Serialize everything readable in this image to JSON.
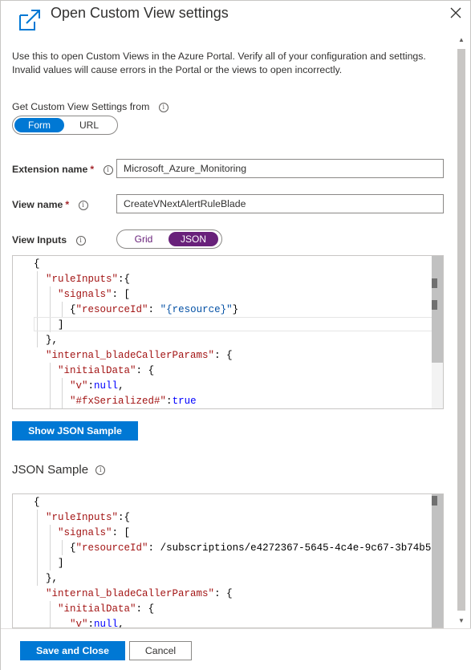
{
  "header": {
    "title": "Open Custom View settings",
    "icon": "open-external-icon",
    "close_icon": "close-icon"
  },
  "description": "Use this to open Custom Views in the Azure Portal. Verify all of your configuration and settings. Invalid values will cause errors in the Portal or the views to open incorrectly.",
  "source": {
    "label": "Get Custom View Settings from",
    "options": [
      "Form",
      "URL"
    ],
    "selected": "Form"
  },
  "extension": {
    "label": "Extension name",
    "required_mark": "*",
    "value": "Microsoft_Azure_Monitoring"
  },
  "view_name": {
    "label": "View name",
    "required_mark": "*",
    "value": "CreateVNextAlertRuleBlade"
  },
  "view_inputs": {
    "label": "View Inputs",
    "options": [
      "Grid",
      "JSON"
    ],
    "selected": "JSON"
  },
  "editor_lines": [
    "{",
    "  \"ruleInputs\":{",
    "    \"signals\": [",
    "      {\"resourceId\": \"{resource}\"}",
    "    ]",
    "  },",
    "  \"internal_bladeCallerParams\": {",
    "    \"initialData\": {",
    "      \"v\":null,",
    "      \"#fxSerialized#\":true"
  ],
  "show_sample_button": "Show JSON Sample",
  "sample": {
    "title": "JSON Sample",
    "lines": [
      "{",
      "  \"ruleInputs\":{",
      "    \"signals\": [",
      "      {\"resourceId\": \"/subscriptions/e4272367-5645-4c4e-9c67-3b74b5",
      "    ]",
      "  },",
      "  \"internal_bladeCallerParams\": {",
      "    \"initialData\": {",
      "      \"v\":null,"
    ]
  },
  "footer": {
    "save_label": "Save and Close",
    "cancel_label": "Cancel"
  },
  "colors": {
    "accent": "#0078d4",
    "json_toggle": "#68217a",
    "json_key": "#a31515",
    "json_string": "#0451a5",
    "json_keyword": "#0000ff"
  }
}
